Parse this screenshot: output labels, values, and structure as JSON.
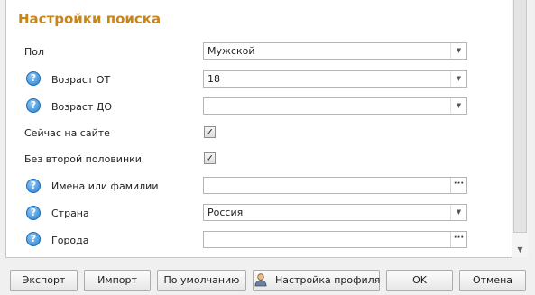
{
  "panel": {
    "title": "Настройки поиска",
    "fields": {
      "gender": {
        "label": "Пол",
        "value": "Мужской"
      },
      "age_from": {
        "label": "Возраст ОТ",
        "value": "18"
      },
      "age_to": {
        "label": "Возраст ДО",
        "value": ""
      },
      "online_now": {
        "label": "Сейчас на сайте",
        "checked": true
      },
      "single": {
        "label": "Без второй половинки",
        "checked": true
      },
      "names": {
        "label": "Имена или фамилии",
        "value": ""
      },
      "country": {
        "label": "Страна",
        "value": "Россия"
      },
      "cities": {
        "label": "Города",
        "value": ""
      }
    },
    "help_glyph": "?",
    "check_glyph": "✓",
    "dots_glyph": "···"
  },
  "buttons": {
    "export": "Экспорт",
    "import": "Импорт",
    "default": "По умолчанию",
    "profile_settings": "Настройка профиля",
    "ok": "OK",
    "cancel": "Отмена"
  },
  "icons": {
    "help": "question-circle-icon",
    "dropdown": "chevron-down-icon",
    "browse": "ellipsis-icon",
    "profile": "user-icon",
    "scroll_down": "arrow-down-icon"
  },
  "colors": {
    "title": "#c8861a",
    "help_icon": "#2a7fcf"
  }
}
